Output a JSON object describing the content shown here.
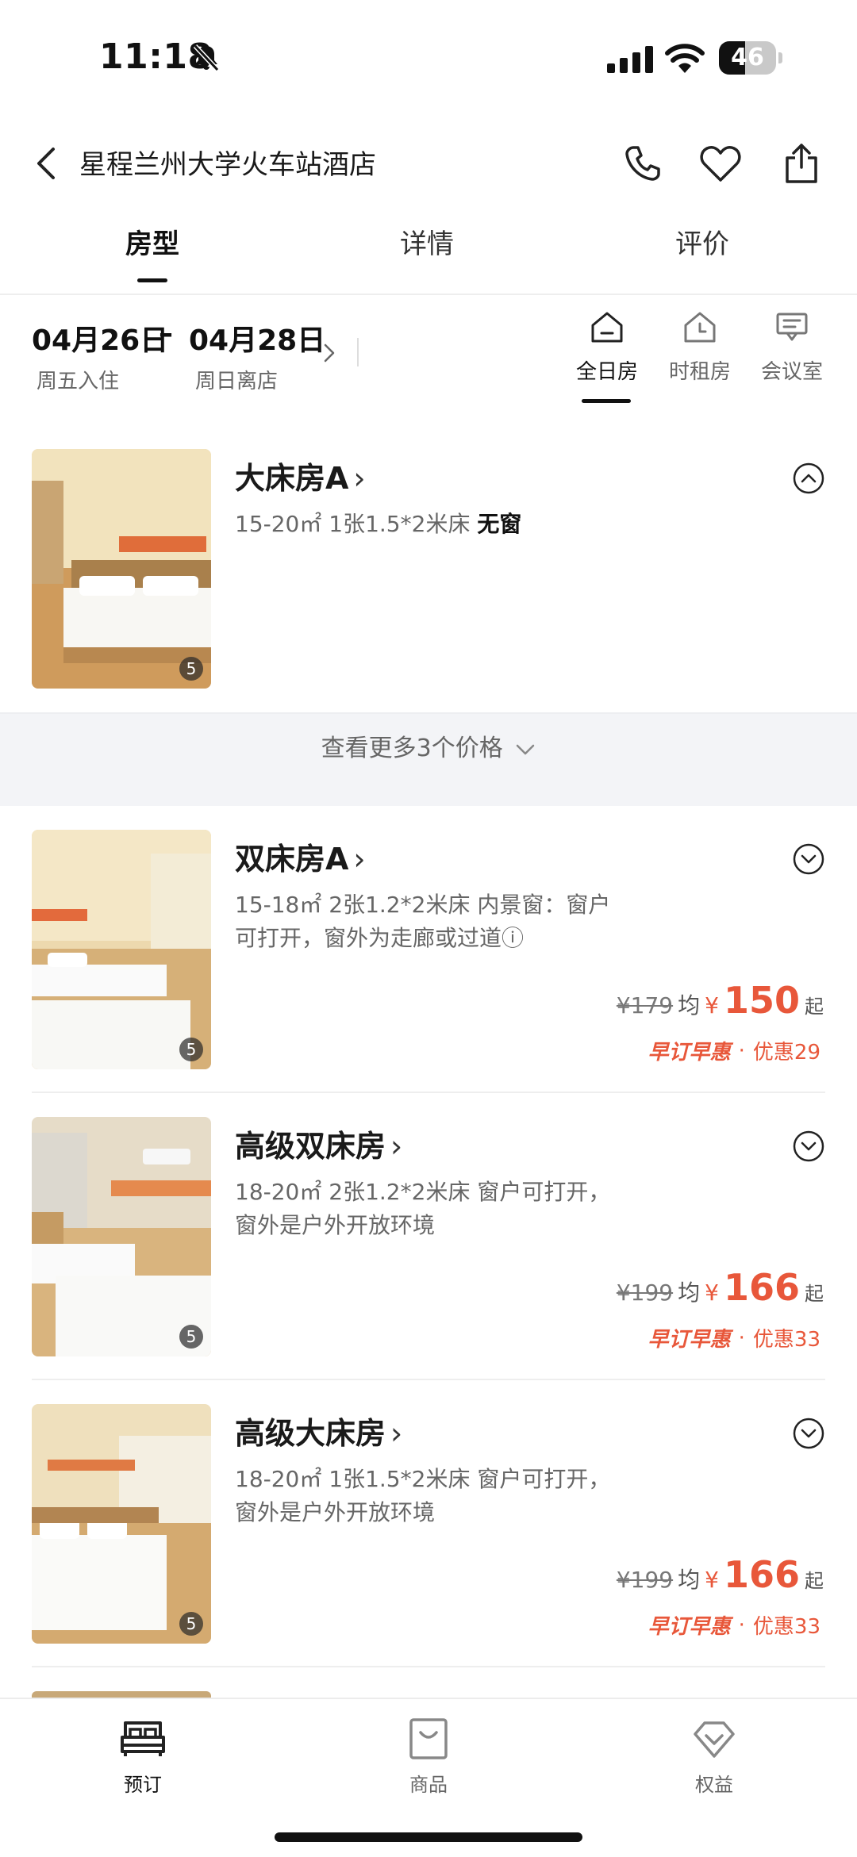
{
  "status_bar": {
    "time": "11:18",
    "battery": "46",
    "battery_level_percent": 46
  },
  "header": {
    "hotel_name": "星程兰州大学火车站酒店"
  },
  "tabs": [
    {
      "label": "房型",
      "active": true
    },
    {
      "label": "详情",
      "active": false
    },
    {
      "label": "评价",
      "active": false
    }
  ],
  "dates": {
    "checkin": "04月26日",
    "checkin_sub": "周五入住",
    "separator": "–",
    "checkout": "04月28日",
    "checkout_sub": "周日离店"
  },
  "modes": [
    {
      "label": "全日房",
      "icon": "house-icon",
      "active": true
    },
    {
      "label": "时租房",
      "icon": "clock-house-icon",
      "active": false
    },
    {
      "label": "会议室",
      "icon": "meeting-room-icon",
      "active": false
    }
  ],
  "rooms": [
    {
      "name": "大床房A",
      "area": "15-20㎡",
      "bed": "1张1.5*2米床",
      "extra": "无窗",
      "photo_count": "5",
      "expanded": true
    },
    {
      "name": "双床房A",
      "area": "15-18㎡",
      "bed": "2张1.2*2米床",
      "desc": "内景窗：窗户可打开，窗外为走廊或过道ⓘ",
      "photo_count": "5",
      "original_price": "¥179",
      "avg_label": "均",
      "currency": "¥",
      "price": "150",
      "from_label": "起",
      "promo_tag": "早订早惠",
      "promo_separator": "·",
      "discount": "优惠29"
    },
    {
      "name": "高级双床房",
      "area": "18-20㎡",
      "bed": "2张1.2*2米床",
      "desc": "窗户可打开，窗外是户外开放环境",
      "photo_count": "5",
      "original_price": "¥199",
      "avg_label": "均",
      "currency": "¥",
      "price": "166",
      "from_label": "起",
      "promo_tag": "早订早惠",
      "promo_separator": "·",
      "discount": "优惠33"
    },
    {
      "name": "高级大床房",
      "area": "18-20㎡",
      "bed": "1张1.5*2米床",
      "desc": "窗户可打开，窗外是户外开放环境",
      "photo_count": "5",
      "original_price": "¥199",
      "avg_label": "均",
      "currency": "¥",
      "price": "166",
      "from_label": "起",
      "promo_tag": "早订早惠",
      "promo_separator": "·",
      "discount": "优惠33"
    }
  ],
  "more_prices": "查看更多3个价格",
  "bottom_nav": [
    {
      "label": "预订",
      "icon": "bed-icon",
      "active": true
    },
    {
      "label": "商品",
      "icon": "shopping-bag-icon",
      "active": false
    },
    {
      "label": "权益",
      "icon": "diamond-icon",
      "active": false
    }
  ],
  "colors": {
    "accent": "#e8573a",
    "text": "#1a1a1a",
    "muted": "#666666",
    "background_gray": "#f3f4f7"
  }
}
